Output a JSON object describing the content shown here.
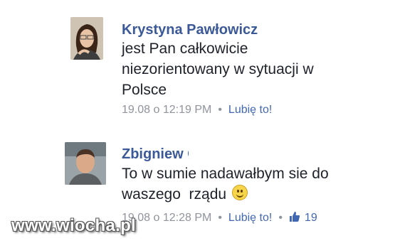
{
  "comments": [
    {
      "author": "Krystyna Pawłowicz",
      "text_lines": [
        "jest Pan całkowicie",
        "niezorientowany w sytuacji w",
        "Polsce"
      ],
      "timestamp": "19.08 o 12:19 PM",
      "like_label": "Lubię to!",
      "avatar": "woman-portrait"
    },
    {
      "author": "Zbigniew C",
      "text_lines": [
        "To w sumie nadawałbym sie do",
        "waszego  rządu"
      ],
      "timestamp": "19.08 o 12:28 PM",
      "like_label": "Lubię to!",
      "like_count": "19",
      "avatar": "man-portrait",
      "emoji": "smiley-emoji"
    }
  ],
  "separator": "•",
  "watermark": "www.wiocha.pl",
  "colors": {
    "author": "#3b5998",
    "link": "#4267b2",
    "meta": "#90949c",
    "text": "#1d2129"
  }
}
